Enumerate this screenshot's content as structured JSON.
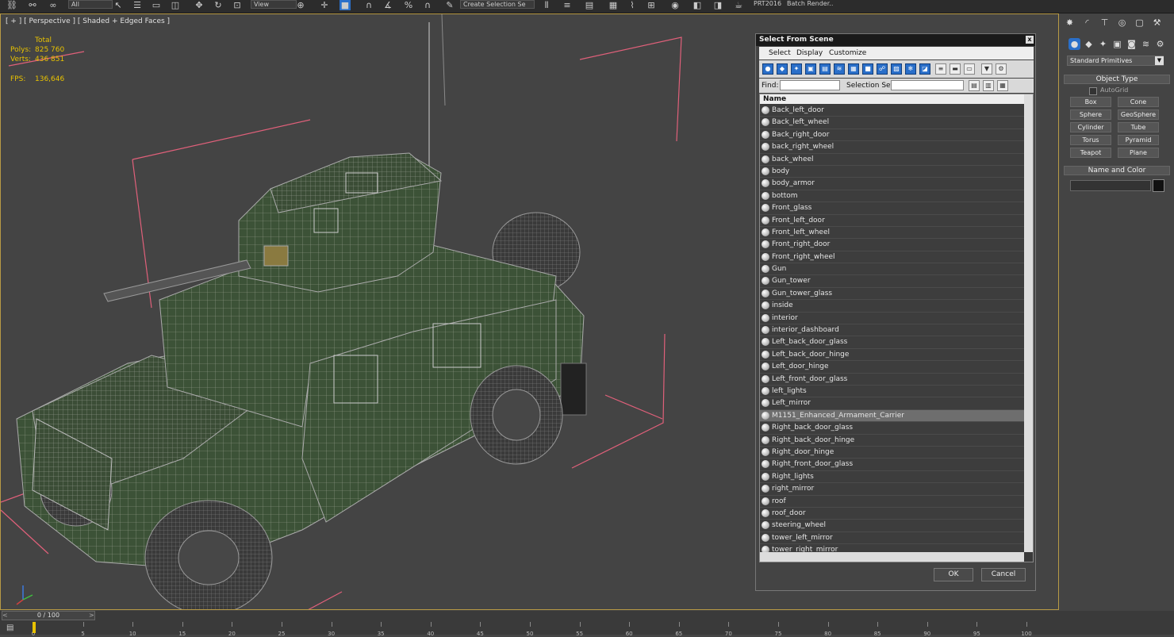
{
  "toolbar": {
    "filter_value": "All",
    "view_value": "View",
    "named_selection_placeholder": "Create Selection Se",
    "prt_label": "PRT2016",
    "batch_render_label": "Batch Render..."
  },
  "viewport": {
    "label": "[ + ] [ Perspective ] [ Shaded + Edged Faces ]",
    "stats": {
      "total_label": "Total",
      "polys_label": "Polys:",
      "polys_value": "825 760",
      "verts_label": "Verts:",
      "verts_value": "436 851",
      "fps_label": "FPS:",
      "fps_value": "136,646"
    }
  },
  "dialog": {
    "title": "Select From Scene",
    "close": "x",
    "menu": [
      "Select",
      "Display",
      "Customize"
    ],
    "find_label": "Find:",
    "selection_set_label": "Selection Set:",
    "column_header": "Name",
    "selected_item": "M1151_Enhanced_Armament_Carrier",
    "items": [
      "Back_left_door",
      "Back_left_wheel",
      "Back_right_door",
      "back_right_wheel",
      "back_wheel",
      "body",
      "body_armor",
      "bottom",
      "Front_glass",
      "Front_left_door",
      "Front_left_wheel",
      "Front_right_door",
      "Front_right_wheel",
      "Gun",
      "Gun_tower",
      "Gun_tower_glass",
      "inside",
      "interior",
      "interior_dashboard",
      "Left_back_door_glass",
      "Left_back_door_hinge",
      "Left_door_hinge",
      "Left_front_door_glass",
      "left_lights",
      "Left_mirror",
      "M1151_Enhanced_Armament_Carrier",
      "Right_back_door_glass",
      "Right_back_door_hinge",
      "Right_door_hinge",
      "Right_front_door_glass",
      "Right_lights",
      "right_mirror",
      "roof",
      "roof_door",
      "steering_wheel",
      "tower_left_mirror",
      "tower_right_mirror"
    ],
    "ok_label": "OK",
    "cancel_label": "Cancel"
  },
  "command_panel": {
    "category_dropdown": "Standard Primitives",
    "object_type_title": "Object Type",
    "autogrid_label": "AutoGrid",
    "primitives": [
      "Box",
      "Cone",
      "Sphere",
      "GeoSphere",
      "Cylinder",
      "Tube",
      "Torus",
      "Pyramid",
      "Teapot",
      "Plane"
    ],
    "name_color_title": "Name and Color",
    "object_color": "#111111"
  },
  "timeline": {
    "frame_display": "0 / 100",
    "ticks": [
      "0",
      "5",
      "10",
      "15",
      "20",
      "25",
      "30",
      "35",
      "40",
      "45",
      "50",
      "55",
      "60",
      "65",
      "70",
      "75",
      "80",
      "85",
      "90",
      "95",
      "100"
    ]
  },
  "colors": {
    "viewport_bg": "#444444",
    "stat_text": "#e8c200",
    "selection_bracket": "#e0607a",
    "model_fill": "#3c5237",
    "wireframe": "#9a9a9a",
    "tool_blue": "#2a6fc9"
  }
}
